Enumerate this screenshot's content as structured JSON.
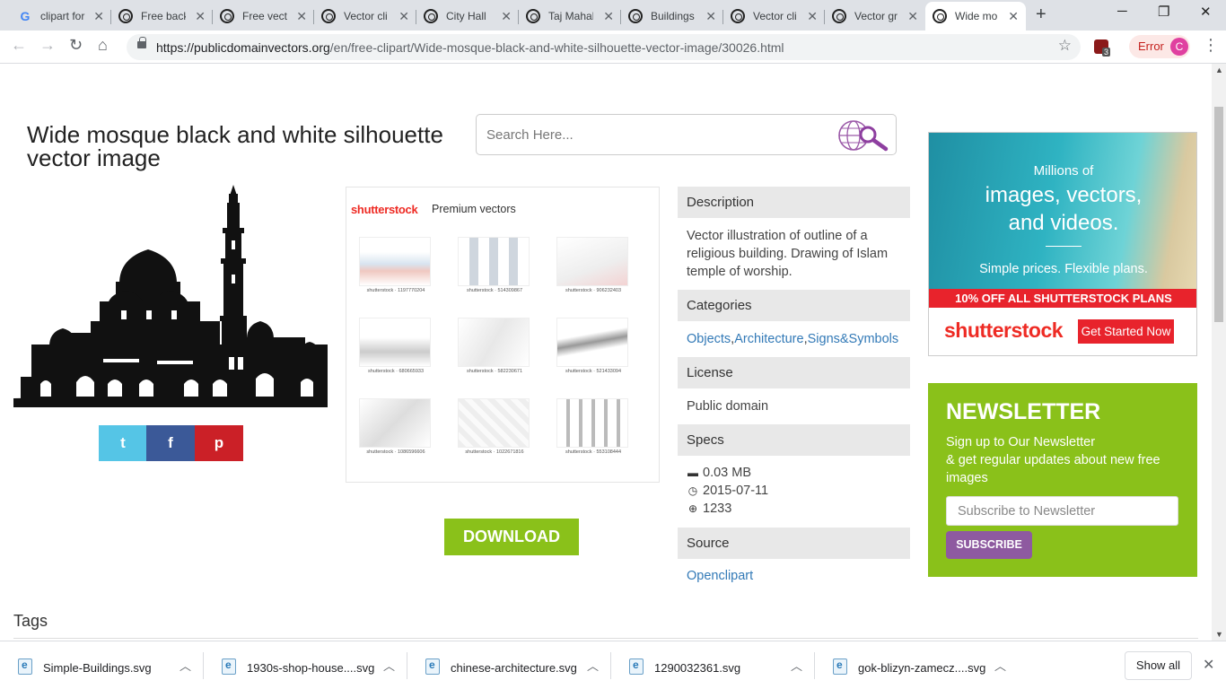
{
  "browser": {
    "tabs": [
      {
        "label": "clipart for",
        "icon": "google-icon"
      },
      {
        "label": "Free back",
        "icon": "pdv-icon"
      },
      {
        "label": "Free vect",
        "icon": "pdv-icon"
      },
      {
        "label": "Vector cli",
        "icon": "pdv-icon"
      },
      {
        "label": "City Hall",
        "icon": "pdv-icon"
      },
      {
        "label": "Taj Mahal",
        "icon": "pdv-icon"
      },
      {
        "label": "Buildings",
        "icon": "pdv-icon"
      },
      {
        "label": "Vector cli",
        "icon": "pdv-icon"
      },
      {
        "label": "Vector gr",
        "icon": "pdv-icon"
      },
      {
        "label": "Wide mo",
        "icon": "pdv-icon",
        "active": true
      }
    ],
    "url_host": "https://publicdomainvectors.org",
    "url_path": "/en/free-clipart/Wide-mosque-black-and-white-silhouette-vector-image/30026.html",
    "extension_badge": "3",
    "error_label": "Error",
    "profile_initial": "C"
  },
  "page": {
    "title": "Wide mosque black and white silhouette vector image",
    "search_placeholder": "Search Here...",
    "social": {
      "twitter": "t",
      "facebook": "f",
      "pinterest": "p"
    },
    "ad": {
      "brand": "shutterstock",
      "label": "Premium vectors",
      "thumbs": [
        "shutterstock · 1197770204",
        "shutterstock · 514309867",
        "shutterstock · 906232403",
        "shutterstock · 680665933",
        "shutterstock · 582230671",
        "shutterstock · 521433094",
        "shutterstock · 1086596606",
        "shutterstock · 1022671816",
        "shutterstock · 553108444"
      ]
    },
    "download_label": "DOWNLOAD",
    "info": {
      "description_heading": "Description",
      "description_text": "Vector illustration of outline of a religious building. Drawing of Islam temple of worship.",
      "categories_heading": "Categories",
      "categories": [
        "Objects",
        "Architecture",
        "Signs&Symbols"
      ],
      "license_heading": "License",
      "license_text": "Public domain",
      "specs_heading": "Specs",
      "specs": {
        "size": "0.03 MB",
        "date": "2015-07-11",
        "downloads": "1233"
      },
      "source_heading": "Source",
      "source_link": "Openclipart"
    },
    "side_ad": {
      "line1": "Millions of",
      "line2": "images, vectors,",
      "line3": "and videos.",
      "line4": "Simple prices. Flexible plans.",
      "band": "10% OFF ALL SHUTTERSTOCK PLANS",
      "brand": "shutterstock",
      "cta": "Get Started Now"
    },
    "newsletter": {
      "heading": "NEWSLETTER",
      "text_line1": "Sign up to Our Newsletter",
      "text_line2": "& get regular updates about new free images",
      "placeholder": "Subscribe to Newsletter",
      "button": "SUBSCRIBE"
    },
    "tags_heading": "Tags"
  },
  "downloads": {
    "items": [
      "Simple-Buildings.svg",
      "1930s-shop-house....svg",
      "chinese-architecture.svg",
      "1290032361.svg",
      "gok-blizyn-zamecz....svg"
    ],
    "show_all": "Show all"
  },
  "colors": {
    "accent_green": "#8ac11a",
    "subscribe_purple": "#8e5aa0",
    "shutterstock_red": "#ee2b24",
    "link_blue": "#337ab7"
  }
}
